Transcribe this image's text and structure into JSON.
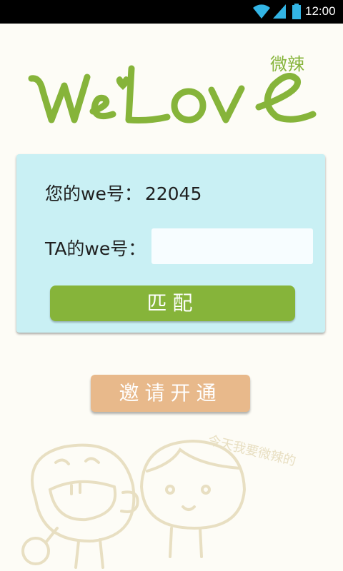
{
  "status_bar": {
    "time": "12:00"
  },
  "logo": {
    "text_main": "WeLove",
    "text_cn": "微辣"
  },
  "card": {
    "my_id_label": "您的we号：",
    "my_id_value": "22045",
    "ta_id_label": "TA的we号：",
    "ta_id_value": "",
    "ta_id_placeholder": "",
    "match_label": "匹配"
  },
  "invite_label": "邀请开通",
  "illustration": {
    "caption": "今天我要微辣的"
  },
  "colors": {
    "green": "#86b43a",
    "card_bg": "#c9f0f4",
    "invite": "#e8b98b",
    "sketch": "#e8dfc2"
  }
}
